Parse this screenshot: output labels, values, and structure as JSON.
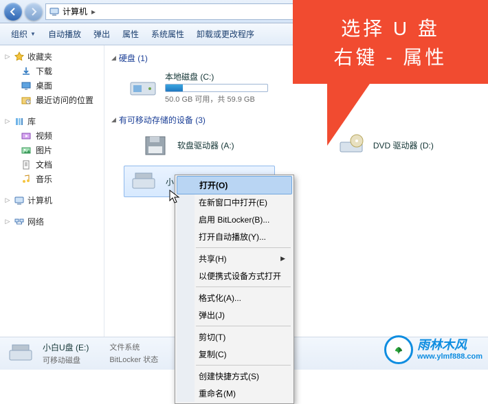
{
  "addr": {
    "location": "计算机"
  },
  "toolbar": {
    "organize": "组织",
    "autoplay": "自动播放",
    "eject": "弹出",
    "properties": "属性",
    "sysprops": "系统属性",
    "uninstall": "卸载或更改程序"
  },
  "sidebar": {
    "fav_head": "收藏夹",
    "fav": [
      "下载",
      "桌面",
      "最近访问的位置"
    ],
    "lib_head": "库",
    "lib": [
      "视频",
      "图片",
      "文档",
      "音乐"
    ],
    "computer": "计算机",
    "network": "网络"
  },
  "main": {
    "cat_hdd": "硬盘 (1)",
    "local_disk": {
      "name": "本地磁盘 (C:)",
      "sub": "50.0 GB 可用，共 59.9 GB",
      "fill_pct": 17
    },
    "cat_removable": "有可移动存储的设备 (3)",
    "floppy": "软盘驱动器 (A:)",
    "dvd": "DVD 驱动器 (D:)",
    "usb": "小白U盘 (E:)"
  },
  "context": {
    "open": "打开(O)",
    "new_window": "在新窗口中打开(E)",
    "bitlocker": "启用 BitLocker(B)...",
    "autoplay": "打开自动播放(Y)...",
    "share": "共享(H)",
    "portable": "以便携式设备方式打开",
    "format": "格式化(A)...",
    "eject": "弹出(J)",
    "cut": "剪切(T)",
    "copy": "复制(C)",
    "shortcut": "创建快捷方式(S)",
    "rename": "重命名(M)"
  },
  "status": {
    "title": "小白U盘 (E:)",
    "sub": "可移动磁盘",
    "fs_label": "文件系统",
    "bl_label": "BitLocker 状态"
  },
  "callout": {
    "line1": "选择 U 盘",
    "line2": "右键 - 属性"
  },
  "watermark": {
    "name": "雨林木风",
    "url": "www.ylmf888.com"
  }
}
